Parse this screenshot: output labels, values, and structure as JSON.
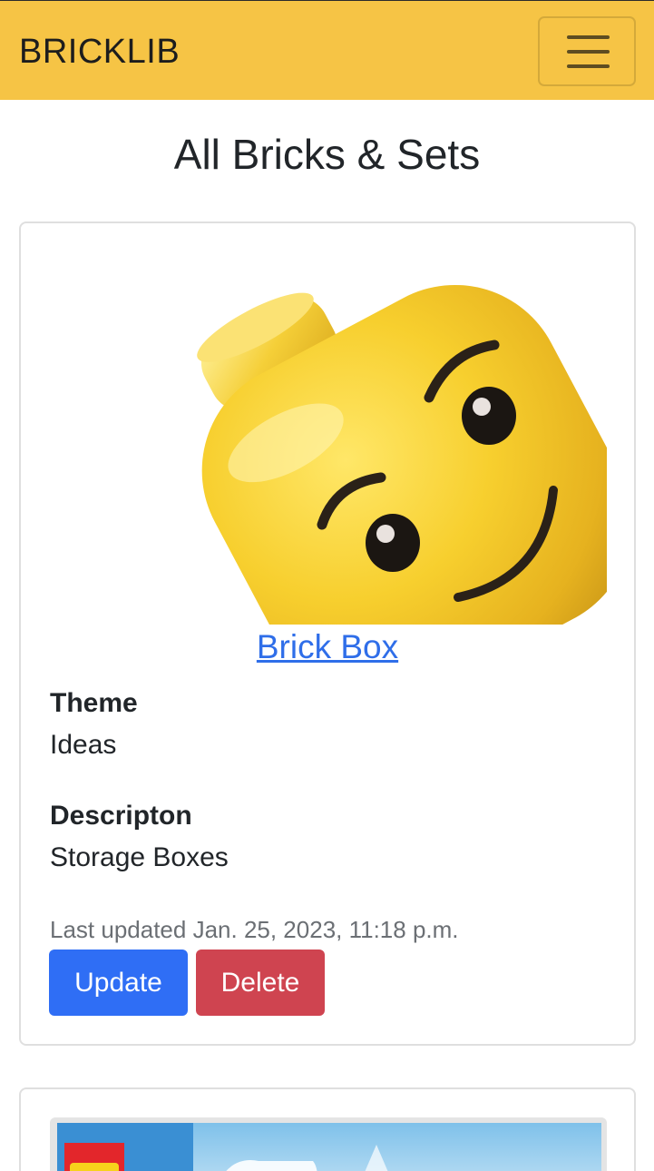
{
  "navbar": {
    "brand": "BRICKLIB",
    "toggler_icon": "hamburger-menu-icon",
    "color": "#f6c445"
  },
  "page": {
    "title": "All Bricks & Sets"
  },
  "items": [
    {
      "image": "lego-minifigure-head-image",
      "title": "Brick Box",
      "theme_label": "Theme",
      "theme": "Ideas",
      "description_label": "Descripton",
      "description": "Storage Boxes",
      "last_updated": "Last updated Jan. 25, 2023, 11:18 p.m.",
      "update_label": "Update",
      "delete_label": "Delete"
    },
    {
      "image": "lego-city-set-box-image"
    }
  ],
  "colors": {
    "link": "#2f6ee9",
    "update_button": "#2f6ef5",
    "delete_button": "#cf4450"
  }
}
